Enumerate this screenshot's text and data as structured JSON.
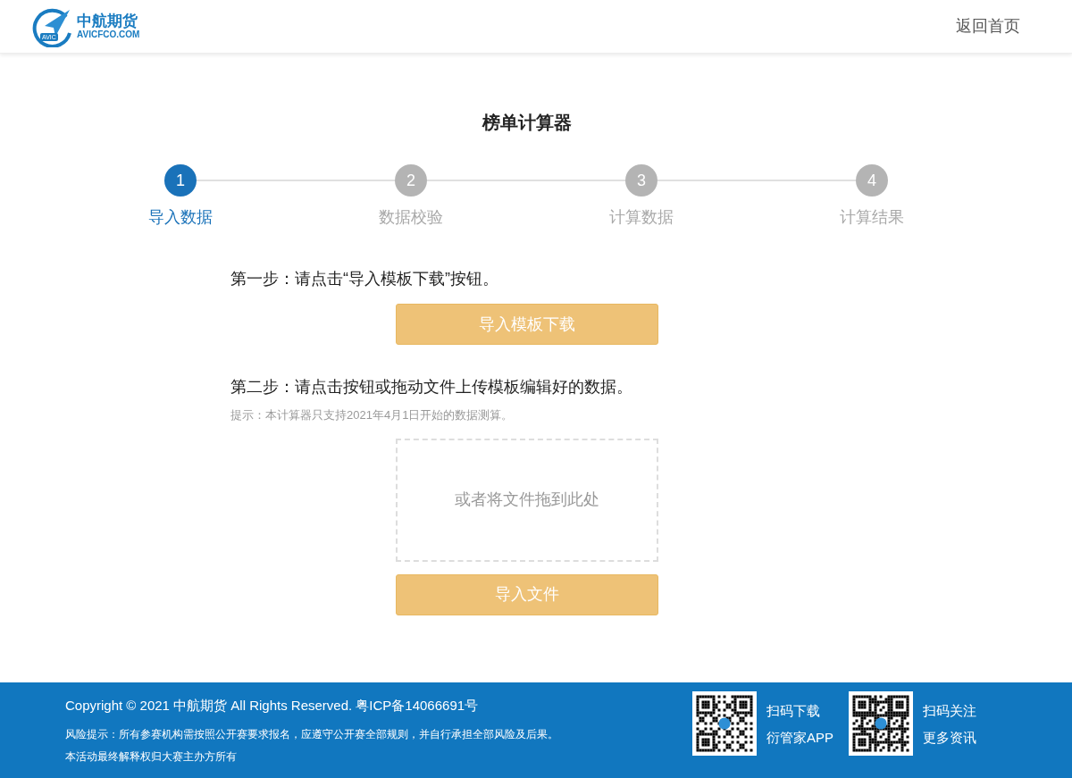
{
  "header": {
    "logo": {
      "badge": "AVIC",
      "name": "中航期货",
      "domain": "AVICFCO.COM"
    },
    "home_link": "返回首页"
  },
  "title": "榜单计算器",
  "steps": [
    {
      "number": "1",
      "label": "导入数据",
      "selected": true
    },
    {
      "number": "2",
      "label": "数据校验",
      "selected": false
    },
    {
      "number": "3",
      "label": "计算数据",
      "selected": false
    },
    {
      "number": "4",
      "label": "计算结果",
      "selected": false
    }
  ],
  "step_one": {
    "instruction": "第一步：请点击“导入模板下载”按钮。",
    "button": "导入模板下载"
  },
  "step_two": {
    "instruction": "第二步：请点击按钮或拖动文件上传模板编辑好的数据。",
    "hint": "提示：本计算器只支持2021年4月1日开始的数据测算。",
    "drop_zone": "或者将文件拖到此处",
    "button": "导入文件"
  },
  "footer": {
    "copyright": "Copyright © 2021 中航期货 All Rights Reserved. 粤ICP备14066691号",
    "risk_notice": "风险提示：所有参赛机构需按照公开赛要求报名，应遵守公开赛全部规则，并自行承担全部风险及后果。",
    "rights_notice": "本活动最终解释权归大赛主办方所有",
    "qr_codes": [
      {
        "line_1": "扫码下载",
        "line_2": "衍管家APP"
      },
      {
        "line_1": "扫码关注",
        "line_2": "更多资讯"
      }
    ]
  }
}
